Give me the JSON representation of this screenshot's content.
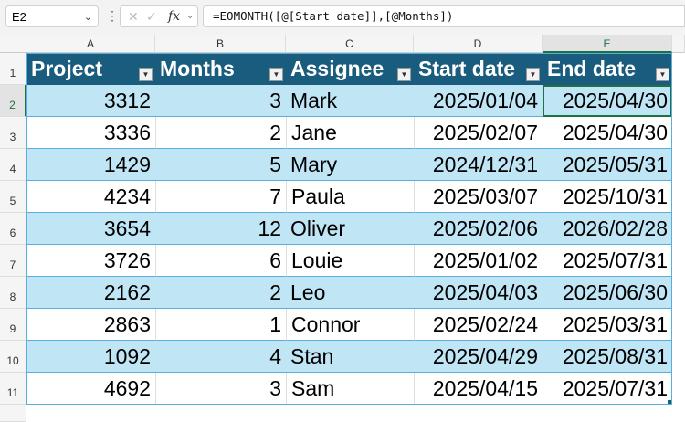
{
  "name_box": "E2",
  "formula": "=EOMONTH([@[Start date]],[@Months])",
  "fx_label": "fx",
  "columns": [
    "A",
    "B",
    "C",
    "D",
    "E"
  ],
  "headers": [
    "Project",
    "Months",
    "Assignee",
    "Start date",
    "End date"
  ],
  "row_numbers": [
    "1",
    "2",
    "3",
    "4",
    "5",
    "6",
    "7",
    "8",
    "9",
    "10",
    "11"
  ],
  "rows": [
    [
      "3312",
      "3",
      "Mark",
      "2025/01/04",
      "2025/04/30"
    ],
    [
      "3336",
      "2",
      "Jane",
      "2025/02/07",
      "2025/04/30"
    ],
    [
      "1429",
      "5",
      "Mary",
      "2024/12/31",
      "2025/05/31"
    ],
    [
      "4234",
      "7",
      "Paula",
      "2025/03/07",
      "2025/10/31"
    ],
    [
      "3654",
      "12",
      "Oliver",
      "2025/02/06",
      "2026/02/28"
    ],
    [
      "3726",
      "6",
      "Louie",
      "2025/01/02",
      "2025/07/31"
    ],
    [
      "2162",
      "2",
      "Leo",
      "2025/04/03",
      "2025/06/30"
    ],
    [
      "2863",
      "1",
      "Connor",
      "2025/02/24",
      "2025/03/31"
    ],
    [
      "1092",
      "4",
      "Stan",
      "2025/04/29",
      "2025/08/31"
    ],
    [
      "4692",
      "3",
      "Sam",
      "2025/04/15",
      "2025/07/31"
    ]
  ],
  "colors": {
    "header": "#1a5c7e",
    "band": "#c0e6f5",
    "selection": "#1e7145"
  }
}
